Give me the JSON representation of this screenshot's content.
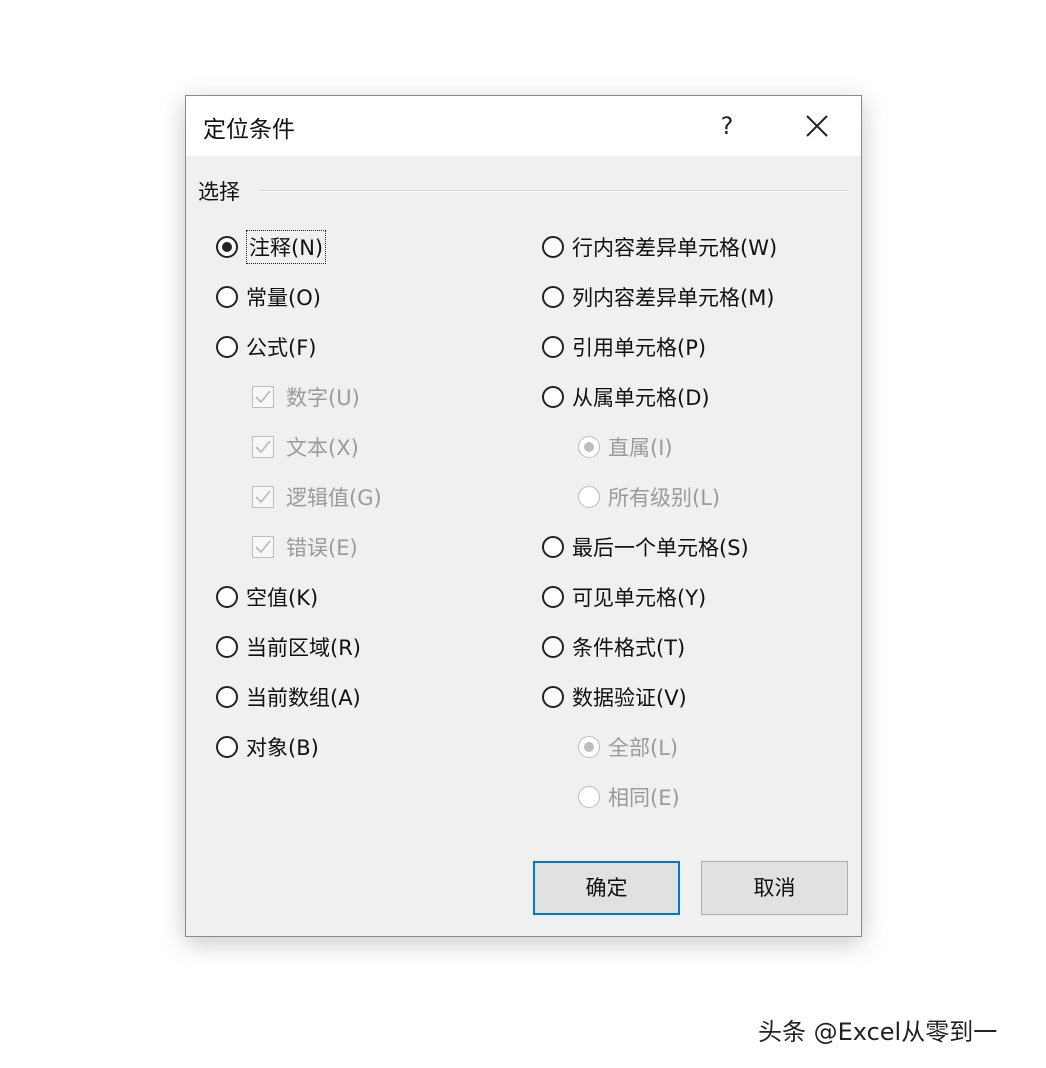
{
  "dialog": {
    "title": "定位条件",
    "help": "?",
    "group_label": "选择"
  },
  "left_options": [
    {
      "label": "注释(N)",
      "kind": "radio",
      "checked": true,
      "disabled": false
    },
    {
      "label": "常量(O)",
      "kind": "radio",
      "checked": false,
      "disabled": false
    },
    {
      "label": "公式(F)",
      "kind": "radio",
      "checked": false,
      "disabled": false
    },
    {
      "label": "数字(U)",
      "kind": "checkbox",
      "checked": true,
      "disabled": true
    },
    {
      "label": "文本(X)",
      "kind": "checkbox",
      "checked": true,
      "disabled": true
    },
    {
      "label": "逻辑值(G)",
      "kind": "checkbox",
      "checked": true,
      "disabled": true
    },
    {
      "label": "错误(E)",
      "kind": "checkbox",
      "checked": true,
      "disabled": true
    },
    {
      "label": "空值(K)",
      "kind": "radio",
      "checked": false,
      "disabled": false
    },
    {
      "label": "当前区域(R)",
      "kind": "radio",
      "checked": false,
      "disabled": false
    },
    {
      "label": "当前数组(A)",
      "kind": "radio",
      "checked": false,
      "disabled": false
    },
    {
      "label": "对象(B)",
      "kind": "radio",
      "checked": false,
      "disabled": false
    }
  ],
  "right_options": [
    {
      "label": "行内容差异单元格(W)",
      "kind": "radio",
      "checked": false,
      "disabled": false
    },
    {
      "label": "列内容差异单元格(M)",
      "kind": "radio",
      "checked": false,
      "disabled": false
    },
    {
      "label": "引用单元格(P)",
      "kind": "radio",
      "checked": false,
      "disabled": false
    },
    {
      "label": "从属单元格(D)",
      "kind": "radio",
      "checked": false,
      "disabled": false
    },
    {
      "label": "直属(I)",
      "kind": "radio",
      "checked": true,
      "disabled": true
    },
    {
      "label": "所有级别(L)",
      "kind": "radio",
      "checked": false,
      "disabled": true
    },
    {
      "label": "最后一个单元格(S)",
      "kind": "radio",
      "checked": false,
      "disabled": false
    },
    {
      "label": "可见单元格(Y)",
      "kind": "radio",
      "checked": false,
      "disabled": false
    },
    {
      "label": "条件格式(T)",
      "kind": "radio",
      "checked": false,
      "disabled": false
    },
    {
      "label": "数据验证(V)",
      "kind": "radio",
      "checked": false,
      "disabled": false
    },
    {
      "label": "全部(L)",
      "kind": "radio",
      "checked": true,
      "disabled": true
    },
    {
      "label": "相同(E)",
      "kind": "radio",
      "checked": false,
      "disabled": true
    }
  ],
  "buttons": {
    "ok": "确定",
    "cancel": "取消"
  },
  "watermark": "头条 @Excel从零到一",
  "colors": {
    "dialog_bg": "#f0f0f0",
    "default_button_border": "#0078d7",
    "disabled_text": "#9a9a9a"
  }
}
